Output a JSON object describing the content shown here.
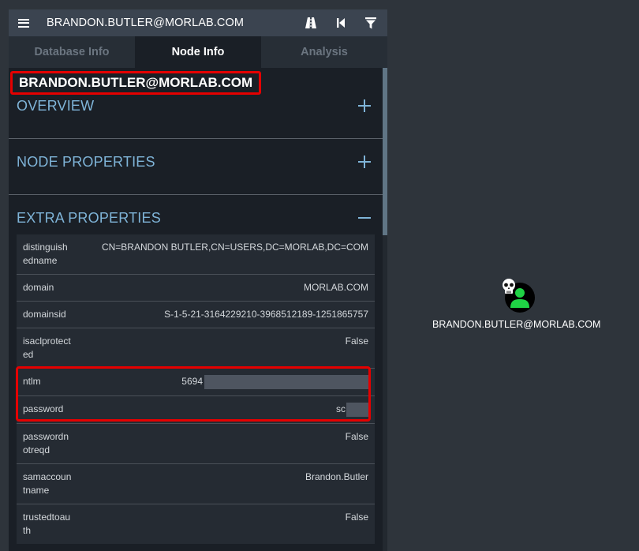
{
  "header": {
    "title": "BRANDON.BUTLER@MORLAB.COM"
  },
  "tabs": [
    {
      "label": "Database Info",
      "active": false
    },
    {
      "label": "Node Info",
      "active": true
    },
    {
      "label": "Analysis",
      "active": false
    }
  ],
  "node": {
    "name": "BRANDON.BUTLER@MORLAB.COM"
  },
  "sections": {
    "overview": "OVERVIEW",
    "node_properties": "NODE PROPERTIES",
    "extra_properties": "EXTRA PROPERTIES"
  },
  "properties": [
    {
      "key": "distinguishedname",
      "value": "CN=BRANDON BUTLER,CN=USERS,DC=MORLAB,DC=COM"
    },
    {
      "key": "domain",
      "value": "MORLAB.COM"
    },
    {
      "key": "domainsid",
      "value": "S-1-5-21-3164229210-3968512189-1251865757"
    },
    {
      "key": "isaclprotected",
      "value": "False"
    },
    {
      "key": "ntlm",
      "value": "5694"
    },
    {
      "key": "password",
      "value": "sc"
    },
    {
      "key": "passwordnotreqd",
      "value": "False"
    },
    {
      "key": "samaccountname",
      "value": "Brandon.Butler"
    },
    {
      "key": "trustedtoauth",
      "value": "False"
    }
  ],
  "graph": {
    "node_label": "BRANDON.BUTLER@MORLAB.COM"
  },
  "colors": {
    "highlight": "#e50000",
    "accent": "#7fb4d8",
    "user_node": "#1fd345"
  },
  "icons": {
    "menu": "hamburger-icon",
    "path": "pathfinding-icon",
    "back": "back-icon",
    "filter": "filter-icon",
    "owned": "skull-icon",
    "user": "user-icon"
  }
}
